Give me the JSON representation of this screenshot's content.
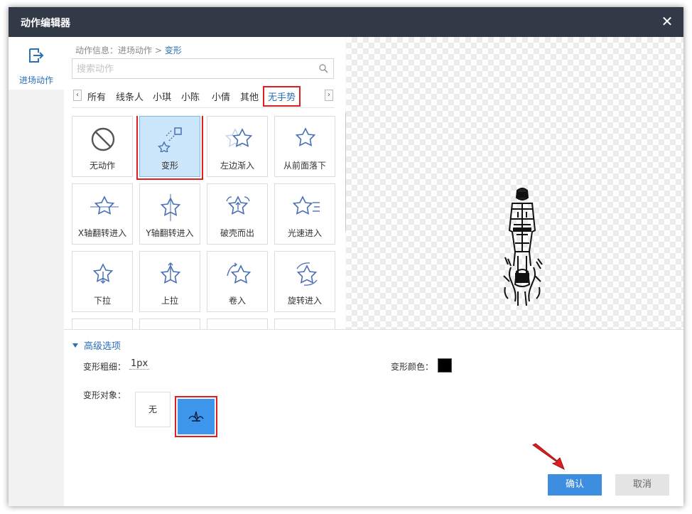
{
  "dialog": {
    "title": "动作编辑器"
  },
  "sidebar": {
    "items": [
      {
        "label": "进场动作",
        "icon": "enter-icon"
      }
    ]
  },
  "breadcrumb": {
    "prefix": "动作信息：进场动作 > ",
    "current": "变形"
  },
  "search": {
    "placeholder": "搜索动作"
  },
  "tabs": [
    "所有",
    "线条人",
    "小琪",
    "小陈",
    "小倩",
    "其他",
    "无手势"
  ],
  "active_tab": "无手势",
  "actions": [
    {
      "label": "无动作",
      "icon": "no-action-icon"
    },
    {
      "label": "变形",
      "icon": "transform-icon"
    },
    {
      "label": "左边渐入",
      "icon": "fade-in-left-icon"
    },
    {
      "label": "从前面落下",
      "icon": "fall-from-front-icon"
    },
    {
      "label": "X轴翻转进入",
      "icon": "x-flip-icon"
    },
    {
      "label": "Y轴翻转进入",
      "icon": "y-flip-icon"
    },
    {
      "label": "破壳而出",
      "icon": "break-out-icon"
    },
    {
      "label": "光速进入",
      "icon": "light-speed-icon"
    },
    {
      "label": "下拉",
      "icon": "pull-down-icon"
    },
    {
      "label": "上拉",
      "icon": "pull-up-icon"
    },
    {
      "label": "卷入",
      "icon": "roll-in-icon"
    },
    {
      "label": "旋转进入",
      "icon": "rotate-in-icon"
    }
  ],
  "selected_action": "变形",
  "advanced": {
    "heading": "高级选项",
    "thickness_label": "变形粗细：",
    "thickness_value": "1px",
    "color_label": "变形颜色：",
    "color": "#000000",
    "object_label": "变形对象：",
    "object_none": "无"
  },
  "buttons": {
    "ok": "确认",
    "cancel": "取消"
  },
  "colors": {
    "accent": "#2a6fb8",
    "titlebar": "#323a47",
    "ok": "#3d8ee0",
    "highlight": "#e02020"
  }
}
